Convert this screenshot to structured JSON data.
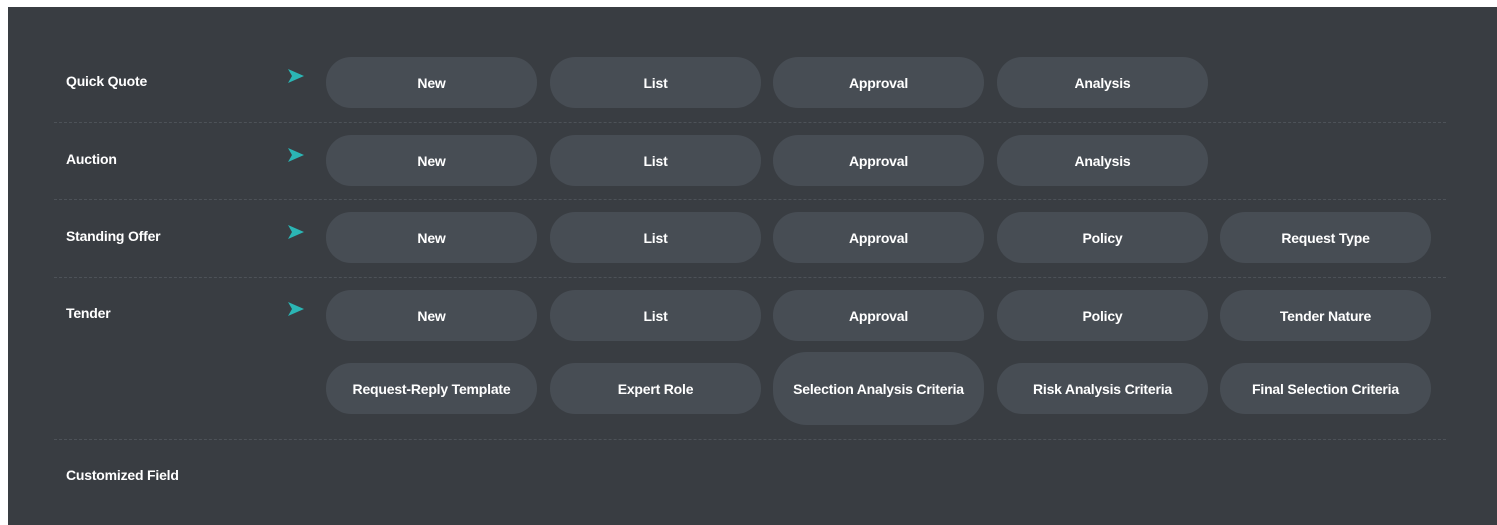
{
  "sections": [
    {
      "label": "Quick Quote",
      "buttons": [
        "New",
        "List",
        "Approval",
        "Analysis"
      ]
    },
    {
      "label": "Auction",
      "buttons": [
        "New",
        "List",
        "Approval",
        "Analysis"
      ]
    },
    {
      "label": "Standing Offer",
      "buttons": [
        "New",
        "List",
        "Approval",
        "Policy",
        "Request Type"
      ]
    },
    {
      "label": "Tender",
      "buttons": [
        "New",
        "List",
        "Approval",
        "Policy",
        "Tender Nature"
      ],
      "buttons_row2": [
        "Request-Reply Template",
        "Expert Role",
        "Selection Analysis Criteria",
        "Risk Analysis Criteria",
        "Final Selection Criteria"
      ]
    },
    {
      "label": "Customized Field",
      "buttons": []
    }
  ],
  "icons": {
    "section_arrow": "chevron-right-icon"
  },
  "colors": {
    "panel_bg": "#393d42",
    "button_bg": "#474d54",
    "arrow": "#2bb6b5",
    "text": "#ffffff"
  }
}
